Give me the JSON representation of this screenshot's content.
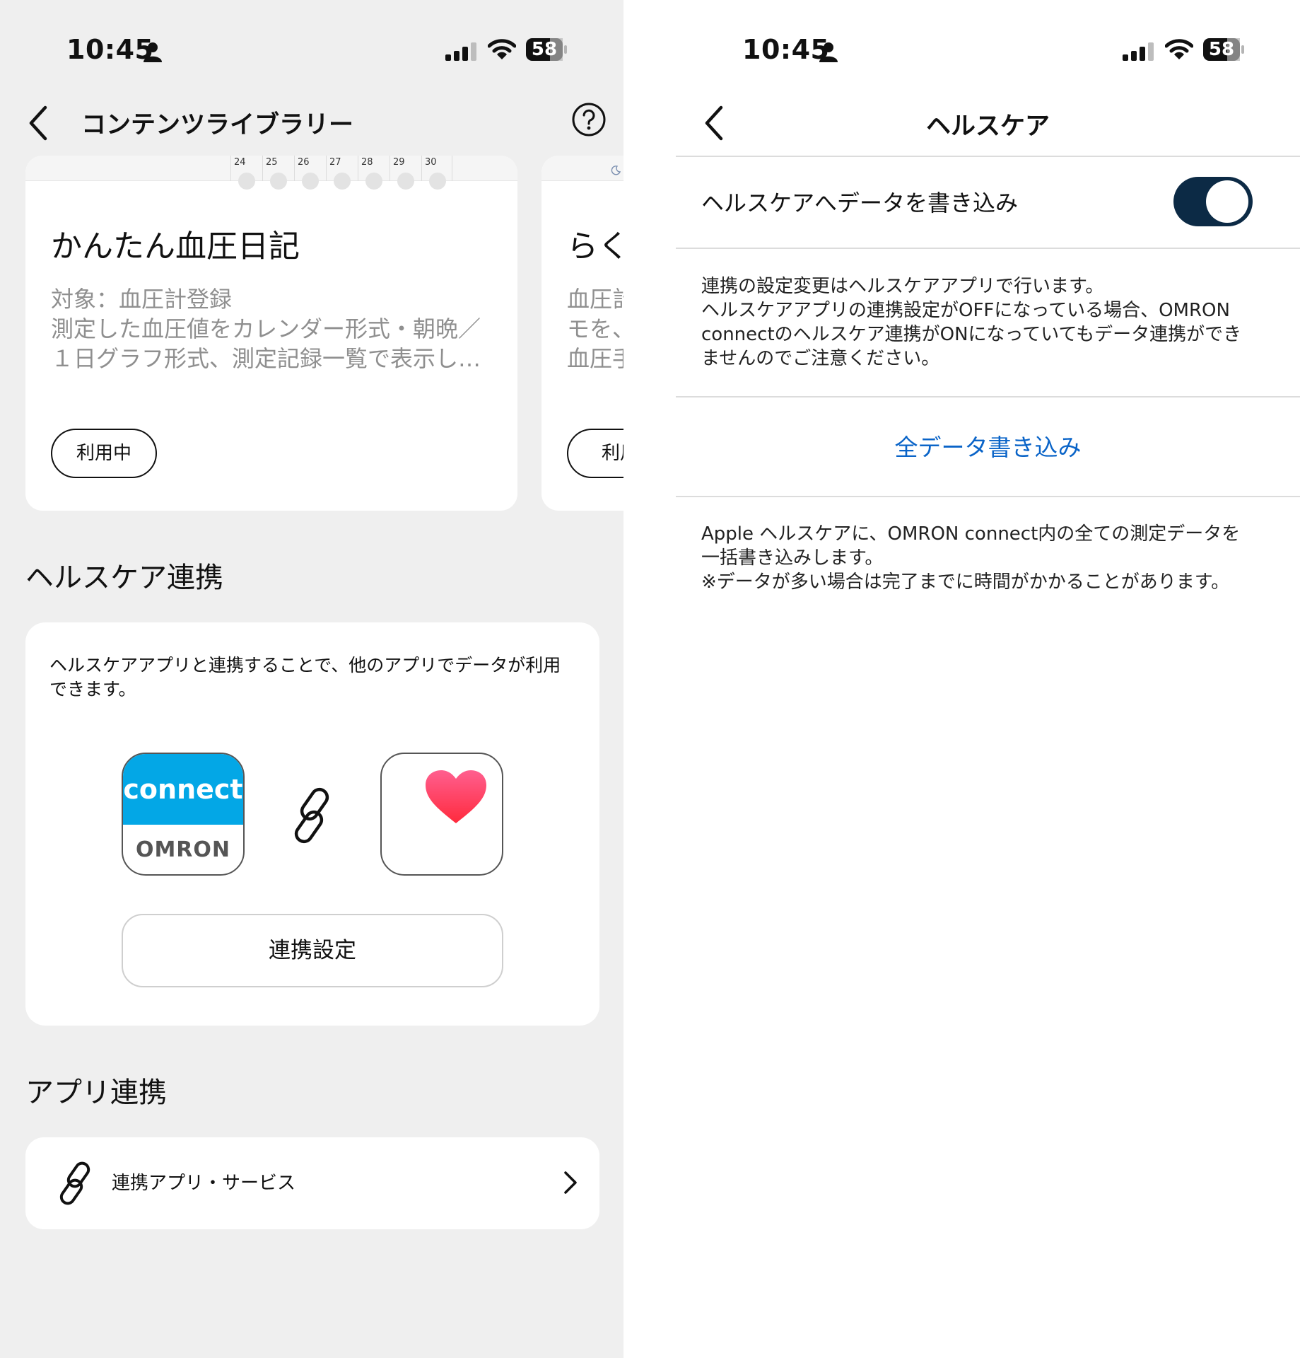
{
  "left": {
    "status": {
      "time": "10:45",
      "battery": "58"
    },
    "nav": {
      "title": "コンテンツライブラリー"
    },
    "calendar_days": [
      "24",
      "25",
      "26",
      "27",
      "28",
      "29",
      "30"
    ],
    "cards": [
      {
        "title": "かんたん血圧日記",
        "desc_lines": [
          "対象：血圧計登録",
          "測定した血圧値をカレンダー形式・朝晩／",
          "１日グラフ形式、測定記録一覧で表示し…"
        ],
        "button": "利用中"
      },
      {
        "title": "らく",
        "desc_lines": [
          "血圧計",
          "モを、",
          "血圧手"
        ],
        "button": "利用"
      }
    ],
    "healthcare": {
      "section_title": "ヘルスケア連携",
      "desc": "ヘルスケアアプリと連携することで、他のアプリでデータが利用できます。",
      "connect_top": "connect",
      "connect_bottom": "OMRON",
      "button": "連携設定"
    },
    "apps": {
      "section_title": "アプリ連携",
      "row_label": "連携アプリ・サービス"
    }
  },
  "right": {
    "status": {
      "time": "10:45",
      "battery": "58"
    },
    "nav": {
      "title": "ヘルスケア"
    },
    "toggle": {
      "label": "ヘルスケアへデータを書き込み",
      "on": true
    },
    "note1": [
      "連携の設定変更はヘルスケアアプリで行います。",
      "ヘルスケアアプリの連携設定がOFFになっている場合、OMRON",
      "connectのヘルスケア連携がONになっていてもデータ連携ができ",
      "ませんのでご注意ください。"
    ],
    "write_all": "全データ書き込み",
    "note2": [
      "Apple ヘルスケアに、OMRON connect内の全ての測定データを",
      "一括書き込みします。",
      "※データが多い場合は完了までに時間がかかることがあります。"
    ]
  },
  "colors": {
    "accent_link": "#0a64c8",
    "toggle_on": "#0c2a45",
    "connect_blue": "#03a7e6",
    "heart": "#ff2d55"
  }
}
